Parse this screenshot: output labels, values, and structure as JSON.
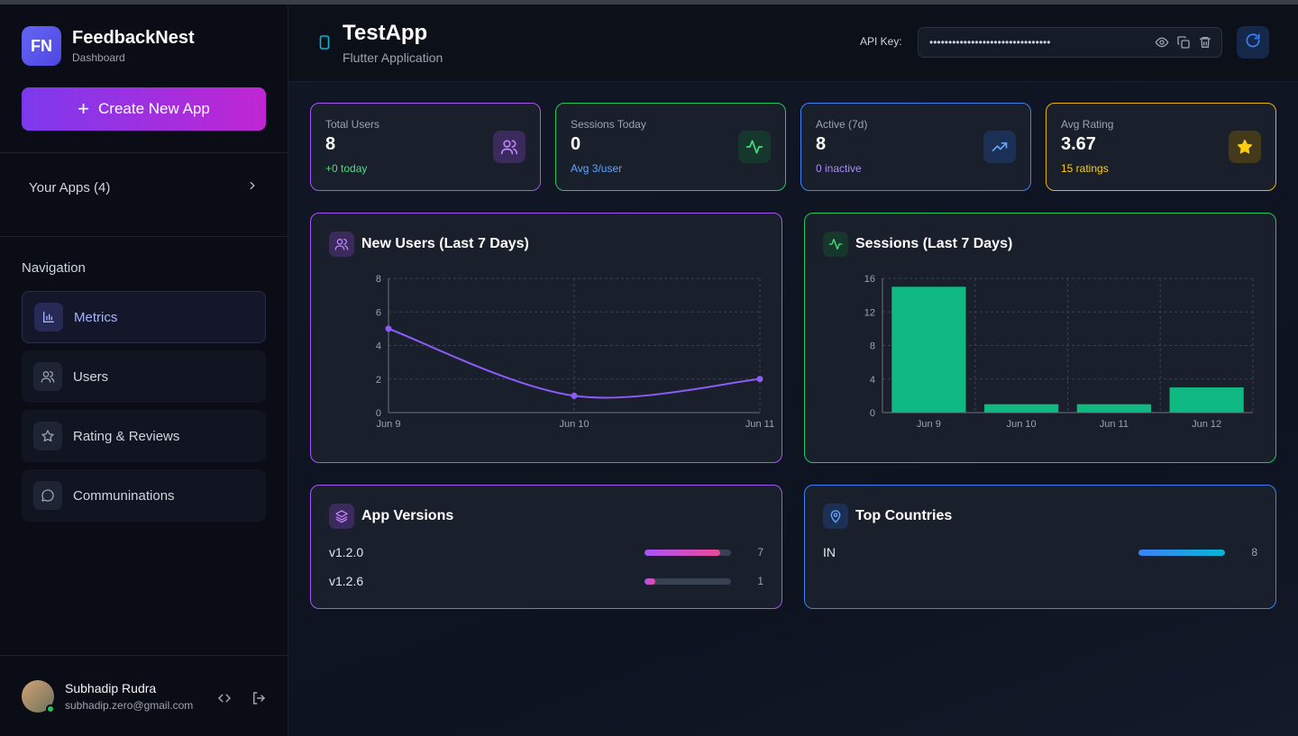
{
  "brand": {
    "initials": "FN",
    "name": "FeedbackNest",
    "subtitle": "Dashboard"
  },
  "sidebar": {
    "create_label": "Create New App",
    "apps_label": "Your Apps (4)",
    "nav_title": "Navigation",
    "items": [
      {
        "label": "Metrics",
        "icon": "bar-chart-icon",
        "active": true
      },
      {
        "label": "Users",
        "icon": "users-icon",
        "active": false
      },
      {
        "label": "Rating & Reviews",
        "icon": "star-icon",
        "active": false
      },
      {
        "label": "Communinations",
        "icon": "message-icon",
        "active": false
      }
    ]
  },
  "user": {
    "name": "Subhadip Rudra",
    "email": "subhadip.zero@gmail.com"
  },
  "header": {
    "app_name": "TestApp",
    "app_type": "Flutter Application",
    "api_label": "API Key:",
    "api_key_masked": "••••••••••••••••••••••••••••••••"
  },
  "stats": [
    {
      "label": "Total Users",
      "value": "8",
      "sub": "+0 today",
      "color": "#a855f7",
      "sub_color": "#4ade80",
      "icon": "users-icon"
    },
    {
      "label": "Sessions Today",
      "value": "0",
      "sub": "Avg 3/user",
      "color": "#22c55e",
      "sub_color": "#60a5fa",
      "icon": "activity-icon"
    },
    {
      "label": "Active (7d)",
      "value": "8",
      "sub": "0 inactive",
      "color": "#3b82f6",
      "sub_color": "#a78bfa",
      "icon": "trending-up-icon"
    },
    {
      "label": "Avg Rating",
      "value": "3.67",
      "sub": "15 ratings",
      "color": "#eab308",
      "sub_color": "#facc15",
      "icon": "star-icon"
    }
  ],
  "panels": {
    "new_users_title": "New Users (Last 7 Days)",
    "sessions_title": "Sessions (Last 7 Days)",
    "versions_title": "App Versions",
    "countries_title": "Top Countries"
  },
  "chart_data": [
    {
      "type": "line",
      "title": "New Users (Last 7 Days)",
      "x": [
        "Jun 9",
        "Jun 10",
        "Jun 11"
      ],
      "series": [
        {
          "values": [
            5,
            1,
            2
          ]
        }
      ],
      "ylim": [
        0,
        8
      ],
      "yticks": [
        0,
        2,
        4,
        6,
        8
      ],
      "grid": true,
      "color": "#8b5cf6"
    },
    {
      "type": "bar",
      "title": "Sessions (Last 7 Days)",
      "categories": [
        "Jun 9",
        "Jun 10",
        "Jun 11",
        "Jun 12"
      ],
      "values": [
        15,
        1,
        1,
        3
      ],
      "ylim": [
        0,
        16
      ],
      "yticks": [
        0,
        4,
        8,
        12,
        16
      ],
      "grid": true,
      "color": "#10b981"
    }
  ],
  "versions": [
    {
      "label": "v1.2.0",
      "count": 7,
      "fraction": 0.875
    },
    {
      "label": "v1.2.6",
      "count": 1,
      "fraction": 0.125
    }
  ],
  "countries": [
    {
      "label": "IN",
      "count": 8,
      "fraction": 1.0
    }
  ]
}
